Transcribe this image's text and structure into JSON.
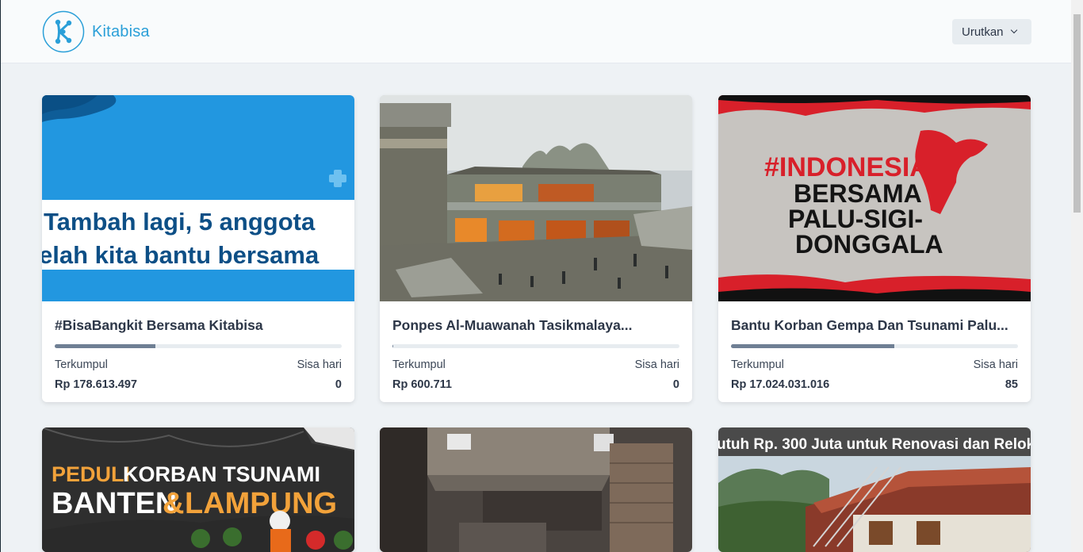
{
  "brand": {
    "name": "Kitabisa",
    "color": "#2a9fd8"
  },
  "sort": {
    "label": "Urutkan",
    "icon": "chevron-down-icon"
  },
  "labels": {
    "collected": "Terkumpul",
    "days_left": "Sisa hari"
  },
  "campaigns": [
    {
      "title": "#BisaBangkit Bersama Kitabisa",
      "collected": "Rp 178.613.497",
      "days_left": "0",
      "progress": 0.35,
      "image_text": [
        "Tambah lagi, 5 anggota",
        "elah kita bantu bersama"
      ]
    },
    {
      "title": "Ponpes Al-Muawanah Tasikmalaya...",
      "collected": "Rp 600.711",
      "days_left": "0",
      "progress": 0.003
    },
    {
      "title": "Bantu Korban Gempa Dan Tsunami Palu...",
      "collected": "Rp 17.024.031.016",
      "days_left": "85",
      "progress": 0.57,
      "image_text": [
        "#INDONESIA",
        "BERSAMA",
        "PALU-SIGI-",
        "DONGGALA"
      ]
    },
    {
      "image_text": [
        "PEDULI",
        "KORBAN TSUNAMI",
        "BANTEN",
        "&",
        "LAMPUNG"
      ]
    },
    {},
    {
      "image_text": [
        "utuh Rp. 300 Juta untuk Renovasi dan Reloka"
      ]
    }
  ]
}
